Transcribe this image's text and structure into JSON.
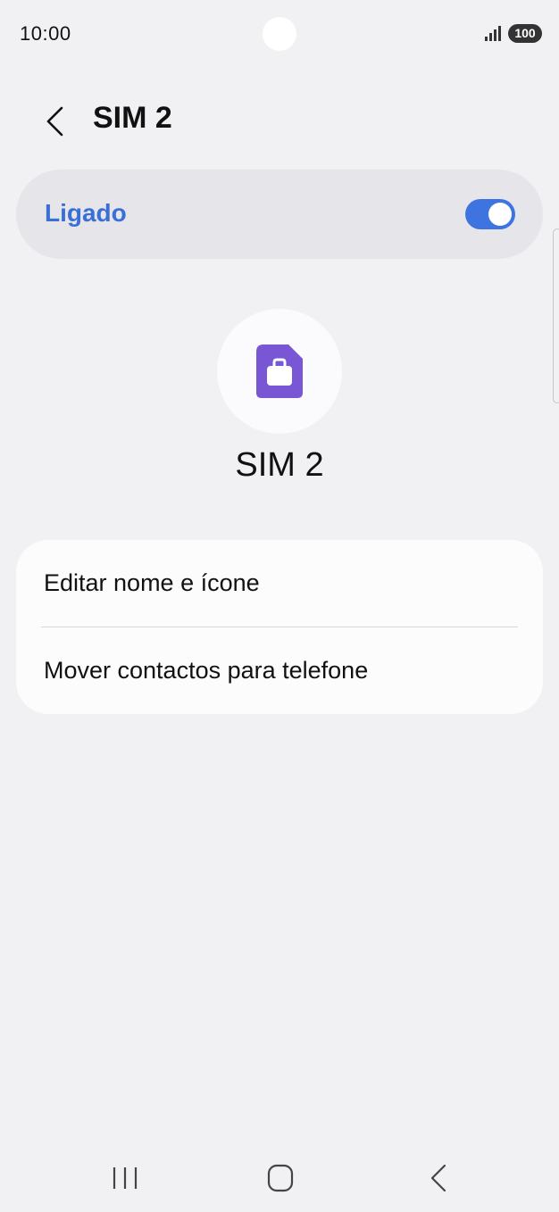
{
  "status_bar": {
    "time": "10:00",
    "battery_level": "100",
    "icons": [
      "signal-icon",
      "battery-icon"
    ]
  },
  "header": {
    "title": "SIM 2",
    "back_icon": "chevron-left-icon"
  },
  "master_switch": {
    "label": "Ligado",
    "state": "on",
    "label_color": "#3b6fd8",
    "track_color": "#3e74e0"
  },
  "sim": {
    "name": "SIM 2",
    "icon": "sim-card-briefcase-icon",
    "icon_color": "#7957d4"
  },
  "options": [
    {
      "label": "Editar nome e ícone"
    },
    {
      "label": "Mover contactos para telefone"
    }
  ],
  "navigation_bar": {
    "icons": [
      "recent-apps-icon",
      "home-icon",
      "back-icon"
    ]
  }
}
